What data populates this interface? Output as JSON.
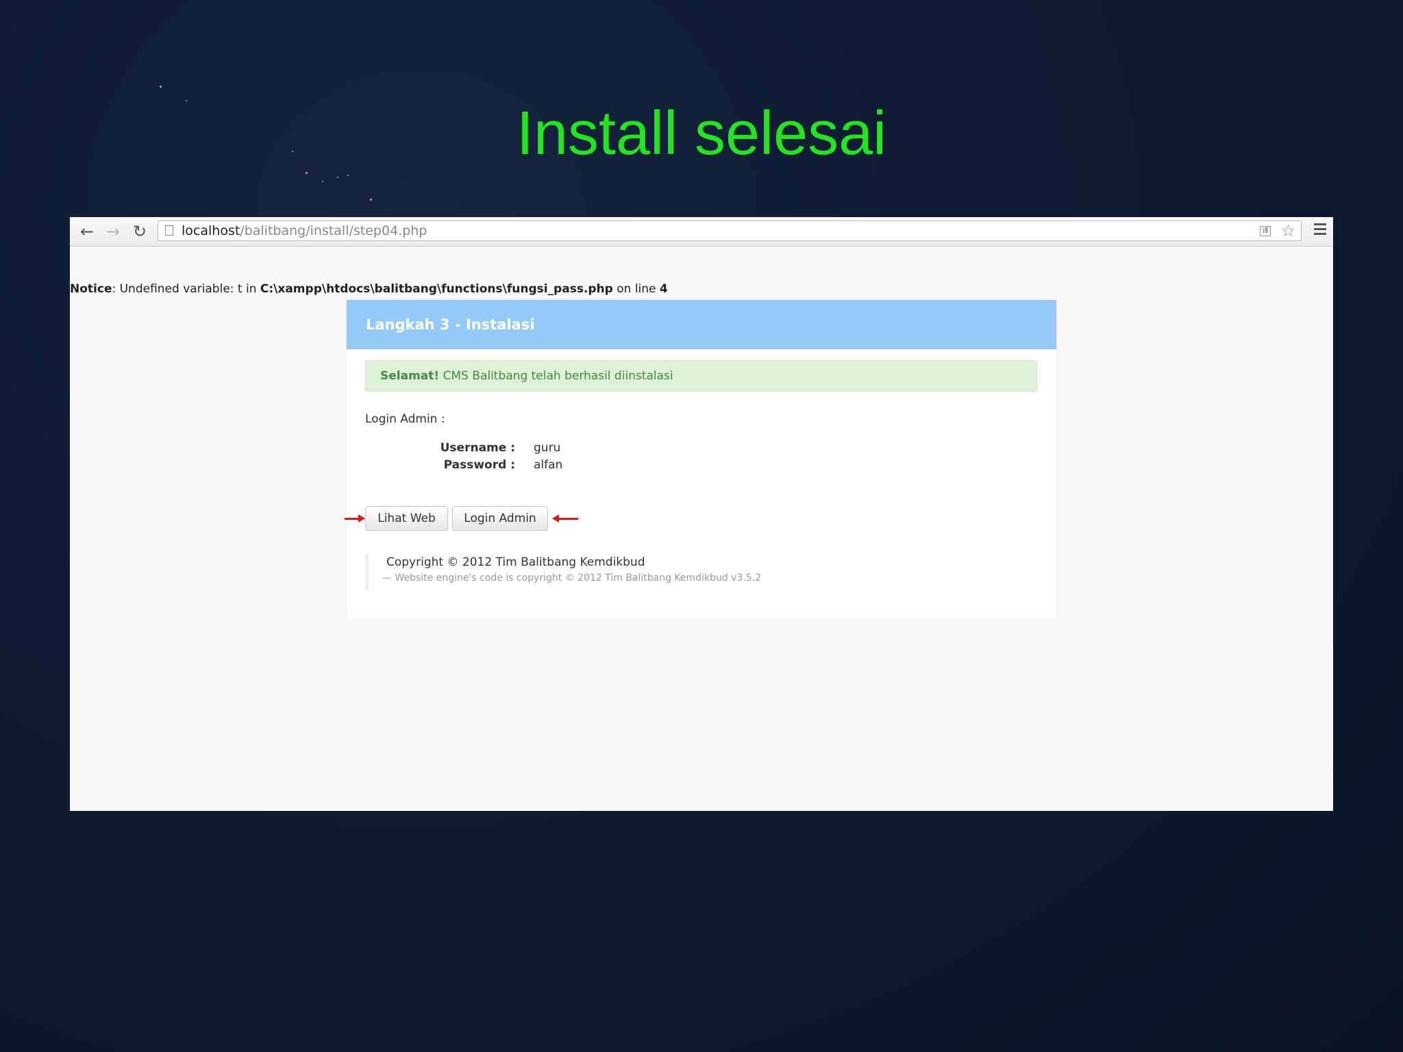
{
  "slide": {
    "title": "Install selesai"
  },
  "browser": {
    "url_host": "localhost",
    "url_path": "/balitbang/install/step04.php",
    "nav": {
      "back_icon": "back-arrow-icon",
      "forward_icon": "forward-arrow-icon",
      "reload_icon": "reload-icon",
      "page_icon": "page-icon",
      "translate_icon": "translate-icon",
      "bookmark_icon": "star-icon",
      "menu_icon": "hamburger-menu-icon"
    }
  },
  "notice": {
    "label": "Notice",
    "message": ": Undefined variable: t in ",
    "path": "C:\\xampp\\htdocs\\balitbang\\functions\\fungsi_pass.php",
    "on_line": " on line ",
    "line": "4"
  },
  "panel": {
    "header": "Langkah 3 - Instalasi",
    "alert_strong": "Selamat!",
    "alert_text": " CMS Balitbang telah berhasil diinstalasi",
    "login_label": "Login Admin :",
    "credentials": [
      {
        "key": "Username :",
        "value": "guru"
      },
      {
        "key": "Password :",
        "value": "alfan"
      }
    ],
    "buttons": {
      "view_web": "Lihat Web",
      "login_admin": "Login Admin"
    },
    "footer": {
      "copyright": "Copyright © 2012 Tim Balitbang Kemdikbud",
      "engine": "— Website engine's code is copyright © 2012 Tim Balitbang Kemdikbud v3.5.2"
    }
  },
  "colors": {
    "title_green": "#22e51f",
    "header_blue": "#95c9f9",
    "alert_bg": "#dff0d8",
    "alert_text": "#468847",
    "arrow_red": "#e8141a",
    "background": "#0e1a31"
  }
}
